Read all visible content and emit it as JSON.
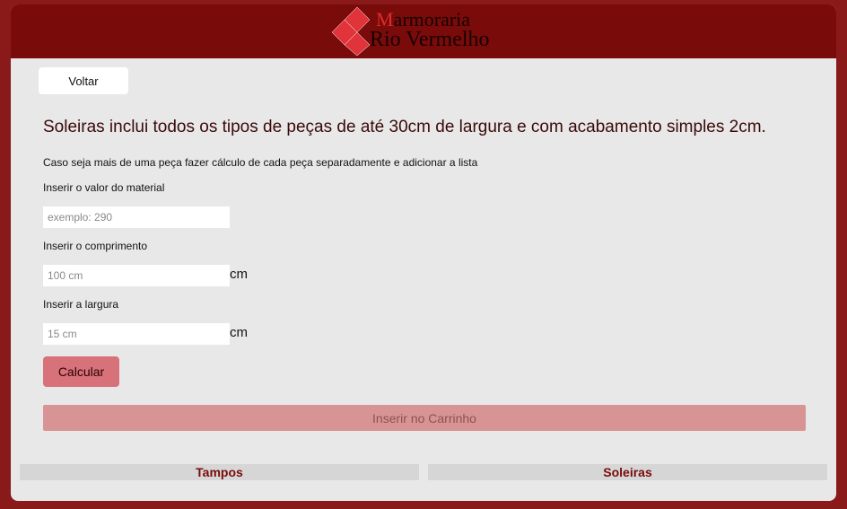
{
  "brand": {
    "line1_initial": "M",
    "line1_rest": "armoraria",
    "line2": "Rio Vermelho",
    "colors": {
      "primary": "#790b0b",
      "accent": "#e02a2a",
      "background": "#8a1a1a"
    }
  },
  "nav": {
    "back_label": "Voltar"
  },
  "content": {
    "headline": "Soleiras inclui todos os tipos de peças de até 30cm de largura e com acabamento simples 2cm.",
    "note": "Caso seja mais de uma peça fazer cálculo de cada peça separadamente e adicionar a lista"
  },
  "form": {
    "material": {
      "label": "Inserir o valor do material",
      "placeholder": "exemplo: 290",
      "value": ""
    },
    "length": {
      "label": "Inserir o comprimento",
      "placeholder": "100 cm",
      "value": "",
      "unit": "cm"
    },
    "width": {
      "label": "Inserir a largura",
      "placeholder": "15 cm",
      "value": "",
      "unit": "cm"
    },
    "calculate_label": "Calcular",
    "add_to_cart_label": "Inserir no Carrinho"
  },
  "tabs": [
    {
      "label": "Tampos"
    },
    {
      "label": "Soleiras"
    }
  ]
}
